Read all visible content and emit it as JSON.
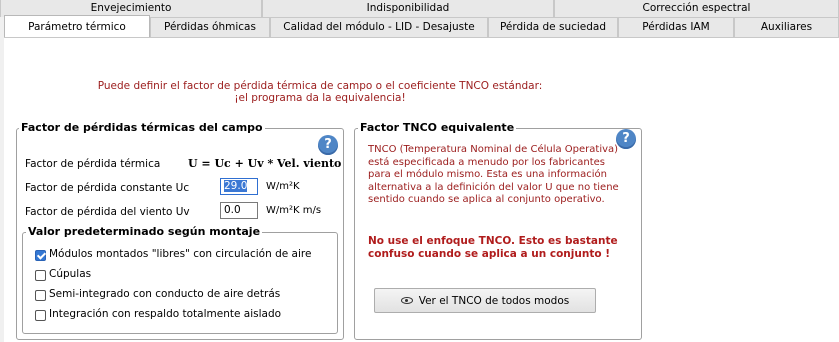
{
  "tabs_row1": [
    "Envejecimiento",
    "Indisponibilidad",
    "Corrección espectral"
  ],
  "tabs_row2": [
    "Parámetro térmico",
    "Pérdidas óhmicas",
    "Calidad del módulo - LID - Desajuste",
    "Pérdida de suciedad",
    "Pérdidas IAM",
    "Auxiliares"
  ],
  "intro": {
    "line1": "Puede definir el factor de pérdida térmica de campo o el coeficiente TNCO estándar:",
    "line2": "¡el programa da la equivalencia!"
  },
  "thermal": {
    "title": "Factor de pérdidas térmicas del campo",
    "help": "?",
    "factor_label": "Factor de pérdida térmica",
    "formula": "U = Uc + Uv * Vel. viento",
    "uc_label": "Factor de pérdida constante Uc",
    "uc_value": "29.0",
    "uc_unit": "W/m²K",
    "uv_label": "Factor de pérdida del viento Uv",
    "uv_value": "0.0",
    "uv_unit": "W/m²K m/s"
  },
  "defaults": {
    "title": "Valor predeterminado según montaje",
    "options": [
      {
        "label": "Módulos montados \"libres\" con circulación de aire",
        "checked": true
      },
      {
        "label": "Cúpulas",
        "checked": false
      },
      {
        "label": "Semi-integrado con conducto de aire detrás",
        "checked": false
      },
      {
        "label": "Integración con respaldo totalmente aislado",
        "checked": false
      }
    ]
  },
  "tnco": {
    "title": "Factor TNCO equivalente",
    "help": "?",
    "info": [
      "TNCO (Temperatura Nominal de Célula Operativa)",
      "está especificada a menudo por los fabricantes",
      "para el módulo mismo. Esta es una información",
      "alternativa a la definición del valor U que no tiene",
      "sentido cuando se aplica al conjunto operativo."
    ],
    "warning": [
      "No use el enfoque TNCO. Esto es bastante",
      "confuso cuando se aplica a un conjunto !"
    ],
    "button_label": "Ver el TNCO de todos modos"
  },
  "colors": {
    "accent": "#3478d4",
    "warning_red": "#b01c1c",
    "info_red": "#9b1c1c"
  }
}
